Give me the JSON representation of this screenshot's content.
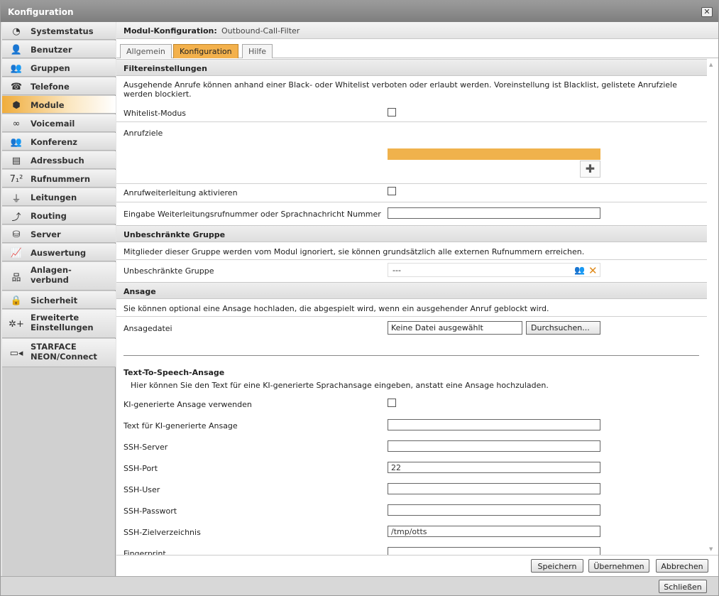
{
  "window": {
    "title": "Konfiguration",
    "close_glyph": "✕"
  },
  "sidebar": {
    "items": [
      {
        "label": "Systemstatus",
        "icon": "pie-chart-icon",
        "glyph": "◔"
      },
      {
        "label": "Benutzer",
        "icon": "user-icon",
        "glyph": "👤"
      },
      {
        "label": "Gruppen",
        "icon": "group-icon",
        "glyph": "👥"
      },
      {
        "label": "Telefone",
        "icon": "phone-icon",
        "glyph": "☎"
      },
      {
        "label": "Module",
        "icon": "cube-icon",
        "glyph": "⬢"
      },
      {
        "label": "Voicemail",
        "icon": "voicemail-icon",
        "glyph": "∞"
      },
      {
        "label": "Konferenz",
        "icon": "conference-icon",
        "glyph": "👥"
      },
      {
        "label": "Adressbuch",
        "icon": "addressbook-icon",
        "glyph": "▤"
      },
      {
        "label": "Rufnummern",
        "icon": "numbers-icon",
        "glyph": "7₁²"
      },
      {
        "label": "Leitungen",
        "icon": "lines-icon",
        "glyph": "⏚"
      },
      {
        "label": "Routing",
        "icon": "routing-icon",
        "glyph": "⤴"
      },
      {
        "label": "Server",
        "icon": "server-icon",
        "glyph": "⛁"
      },
      {
        "label": "Auswertung",
        "icon": "chart-icon",
        "glyph": "📈"
      },
      {
        "label": "Anlagen-\nverbund",
        "icon": "network-icon",
        "glyph": "品"
      },
      {
        "label": "Sicherheit",
        "icon": "lock-icon",
        "glyph": "🔒"
      },
      {
        "label": "Erweiterte\nEinstellungen",
        "icon": "advanced-settings-icon",
        "glyph": "✲+"
      },
      {
        "label": "STARFACE\nNEON/Connect",
        "icon": "video-icon",
        "glyph": "▭◂"
      }
    ]
  },
  "module_header": {
    "label": "Modul-Konfiguration:",
    "value": "Outbound-Call-Filter"
  },
  "tabs": [
    {
      "label": "Allgemein"
    },
    {
      "label": "Konfiguration"
    },
    {
      "label": "Hilfe"
    }
  ],
  "filter": {
    "header": "Filtereinstellungen",
    "description": "Ausgehende Anrufe können anhand einer Black- oder Whitelist verboten oder erlaubt werden. Voreinstellung ist Blacklist, gelistete Anrufziele werden blockiert.",
    "whitelist_label": "Whitelist-Modus",
    "targets_label": "Anrufziele",
    "forward_label": "Anrufweiterleitung aktivieren",
    "forward_number_label": "Eingabe Weiterleitungsrufnummer oder Sprachnachricht Nummer",
    "forward_number_value": "",
    "add_glyph": "✚"
  },
  "unrestricted": {
    "header": "Unbeschränkte Gruppe",
    "description": "Mitglieder dieser Gruppe werden vom Modul ignoriert, sie können grundsätzlich alle externen Rufnummern erreichen.",
    "group_label": "Unbeschränkte Gruppe",
    "group_value": "---"
  },
  "announcement": {
    "header": "Ansage",
    "description": "Sie können optional eine Ansage hochladen, die abgespielt wird, wenn ein ausgehender Anruf geblockt wird.",
    "file_label": "Ansagedatei",
    "file_value": "Keine Datei ausgewählt",
    "browse_label": "Durchsuchen..."
  },
  "tts": {
    "title": "Text-To-Speech-Ansage",
    "description": "Hier können Sie den Text für eine KI-generierte Sprachansage eingeben, anstatt eine Ansage hochzuladen.",
    "use_ai_label": "KI-generierte Ansage verwenden",
    "text_label": "Text für KI-generierte Ansage",
    "text_value": "",
    "ssh_server_label": "SSH-Server",
    "ssh_server_value": "",
    "ssh_port_label": "SSH-Port",
    "ssh_port_value": "22",
    "ssh_user_label": "SSH-User",
    "ssh_user_value": "",
    "ssh_password_label": "SSH-Passwort",
    "ssh_password_value": "",
    "ssh_dir_label": "SSH-Zielverzeichnis",
    "ssh_dir_value": "/tmp/otts",
    "fingerprint_label": "Fingerprint",
    "fingerprint_value": ""
  },
  "footer": {
    "save": "Speichern",
    "apply": "Übernehmen",
    "cancel": "Abbrechen"
  },
  "bottom": {
    "close": "Schließen"
  },
  "colors": {
    "accent": "#f3b14c",
    "title_bar": "#8a8a8a"
  }
}
